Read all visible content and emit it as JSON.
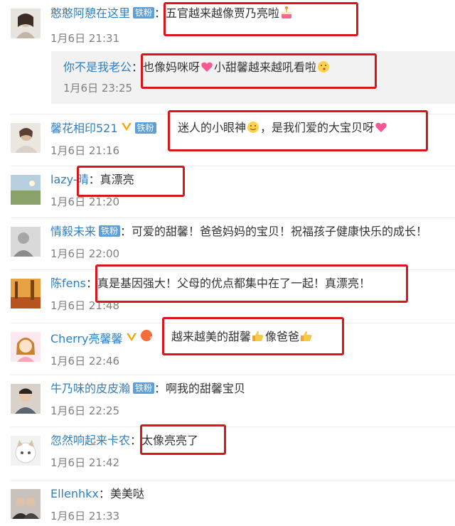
{
  "comments": [
    {
      "user": "憨憨阿憩在这里",
      "badge": "铁粉",
      "verified": false,
      "sep": "：",
      "text": "五官越来越像贾乃亮啦",
      "time": "1月6日 21:31",
      "emoji": "cake-emoji"
    },
    {
      "user": "馨花相印521",
      "badge": "铁粉",
      "verified": true,
      "sep": "：",
      "text": "迷人的小眼神",
      "text2": "，是我们爱的大宝贝呀",
      "time": "1月6日 21:16"
    },
    {
      "user": "lazy-晴",
      "sep": "：",
      "text": "真漂亮",
      "time": "1月6日 21:20"
    },
    {
      "user": "情毅未来",
      "badge": "铁粉",
      "sep": "：",
      "text": "可爱的甜馨！爸爸妈妈的宝贝！祝福孩子健康快乐的成长！",
      "time": "1月6日 22:00"
    },
    {
      "user": "陈fens",
      "sep": "：",
      "text": "真是基因强大！父母的优点都集中在了一起！真漂亮！",
      "time": "1月6日 21:48"
    },
    {
      "user": "Cherry亮馨馨",
      "badge_level": "5",
      "verified": true,
      "sep": "：",
      "text": "越来越美的甜馨",
      "text2": "像爸爸",
      "time": "1月6日 22:46"
    },
    {
      "user": "牛乃味的皮皮瀚",
      "badge": "铁粉",
      "sep": "：",
      "text": "啊我的甜馨宝贝",
      "time": "1月6日 22:25"
    },
    {
      "user": "忽然响起来卡农",
      "sep": "：",
      "text": "太像亮亮了",
      "time": "1月6日 21:42"
    },
    {
      "user": "Ellenhkx",
      "sep": "：",
      "text": "美美哒",
      "time": "1月6日 21:33"
    }
  ],
  "reply": {
    "user": "你不是我老公",
    "sep": "：",
    "text": "也像妈咪呀",
    "text2": "小甜馨越来越吼看啦",
    "time": "1月6日 23:25"
  },
  "colors": {
    "username": "#2f7fc4",
    "badge": "#5e9fd9",
    "highlight": "#d9161c",
    "time": "#808080"
  }
}
